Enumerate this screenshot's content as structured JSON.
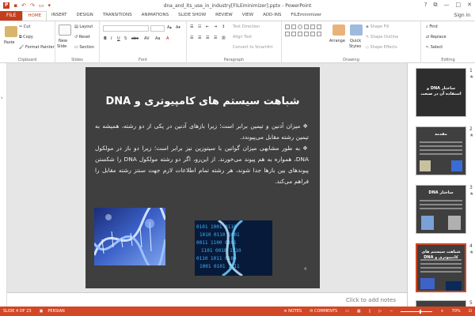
{
  "window": {
    "doc_title": "dna_and_its_use_in_industry[FILEminimizer].pptx - PowerPoint",
    "help": "?",
    "restore": "⧉",
    "minimize": "—",
    "maximize": "□",
    "close": "✕"
  },
  "tabs": {
    "file": "FILE",
    "items": [
      "HOME",
      "INSERT",
      "DESIGN",
      "TRANSITIONS",
      "ANIMATIONS",
      "SLIDE SHOW",
      "REVIEW",
      "VIEW",
      "ADD-INS",
      "FILEminimizer"
    ],
    "sign_in": "Sign in"
  },
  "ribbon": {
    "clipboard": {
      "paste": "Paste",
      "cut": "Cut",
      "copy": "Copy",
      "format_painter": "Format Painter",
      "label": "Clipboard"
    },
    "slides": {
      "new_slide": "New",
      "new_slide2": "Slide",
      "layout": "Layout",
      "reset": "Reset",
      "section": "Section",
      "label": "Slides"
    },
    "font": {
      "label": "Font"
    },
    "paragraph": {
      "text_direction": "Text Direction",
      "align_text": "Align Text",
      "convert": "Convert to SmartArt",
      "label": "Paragraph"
    },
    "drawing": {
      "arrange": "Arrange",
      "quick_styles": "Quick",
      "quick_styles2": "Styles",
      "shape_fill": "Shape Fill",
      "shape_outline": "Shape Outline",
      "shape_effects": "Shape Effects",
      "label": "Drawing"
    },
    "editing": {
      "find": "Find",
      "replace": "Replace",
      "select": "Select",
      "label": "Editing"
    }
  },
  "slide": {
    "title": "شباهت سیستم های کامپیوتری و DNA",
    "bullets": [
      "میزان آدنین و تیمین برابر است؛ زیرا بازهای آدنین در یکی از دو رشته، همیشه به تیمین رشته مقابل می‌پیوندد.",
      "به طور مشابهی میزان گوانین با سیتوزین نیز برابر است؛ زیرا دو باز در مولکول DNA، همواره به هم پیوند می‌خورند. از این‌رو، اگر دو رشته مولکول DNA را شکستن پیوندهای بین بازها جدا شوند، هر رشته تمام اطلاعات لازم جهت سنتز رشته مقابل را فراهم می‌کند."
    ],
    "bullet_char": "❖",
    "page_number": "4"
  },
  "notes_hint": "Click to add notes",
  "thumbnails": [
    {
      "num": "1",
      "title": "ساختار DNA و استفاده آن در صنعت"
    },
    {
      "num": "2",
      "title": "مقدمه"
    },
    {
      "num": "3",
      "title": "ساختار DNA"
    },
    {
      "num": "4",
      "title": "شباهت سیستم های کامپیوتری و DNA"
    },
    {
      "num": "5",
      "title": ""
    }
  ],
  "star": "★",
  "status": {
    "slide_of": "SLIDE 4 OF 23",
    "language": "PERSIAN",
    "notes": "NOTES",
    "comments": "COMMENTS",
    "zoom": "70%"
  },
  "colors": {
    "accent": "#d24726",
    "file_tab": "#c43e1c",
    "slide_bg": "#3f3f3f"
  }
}
